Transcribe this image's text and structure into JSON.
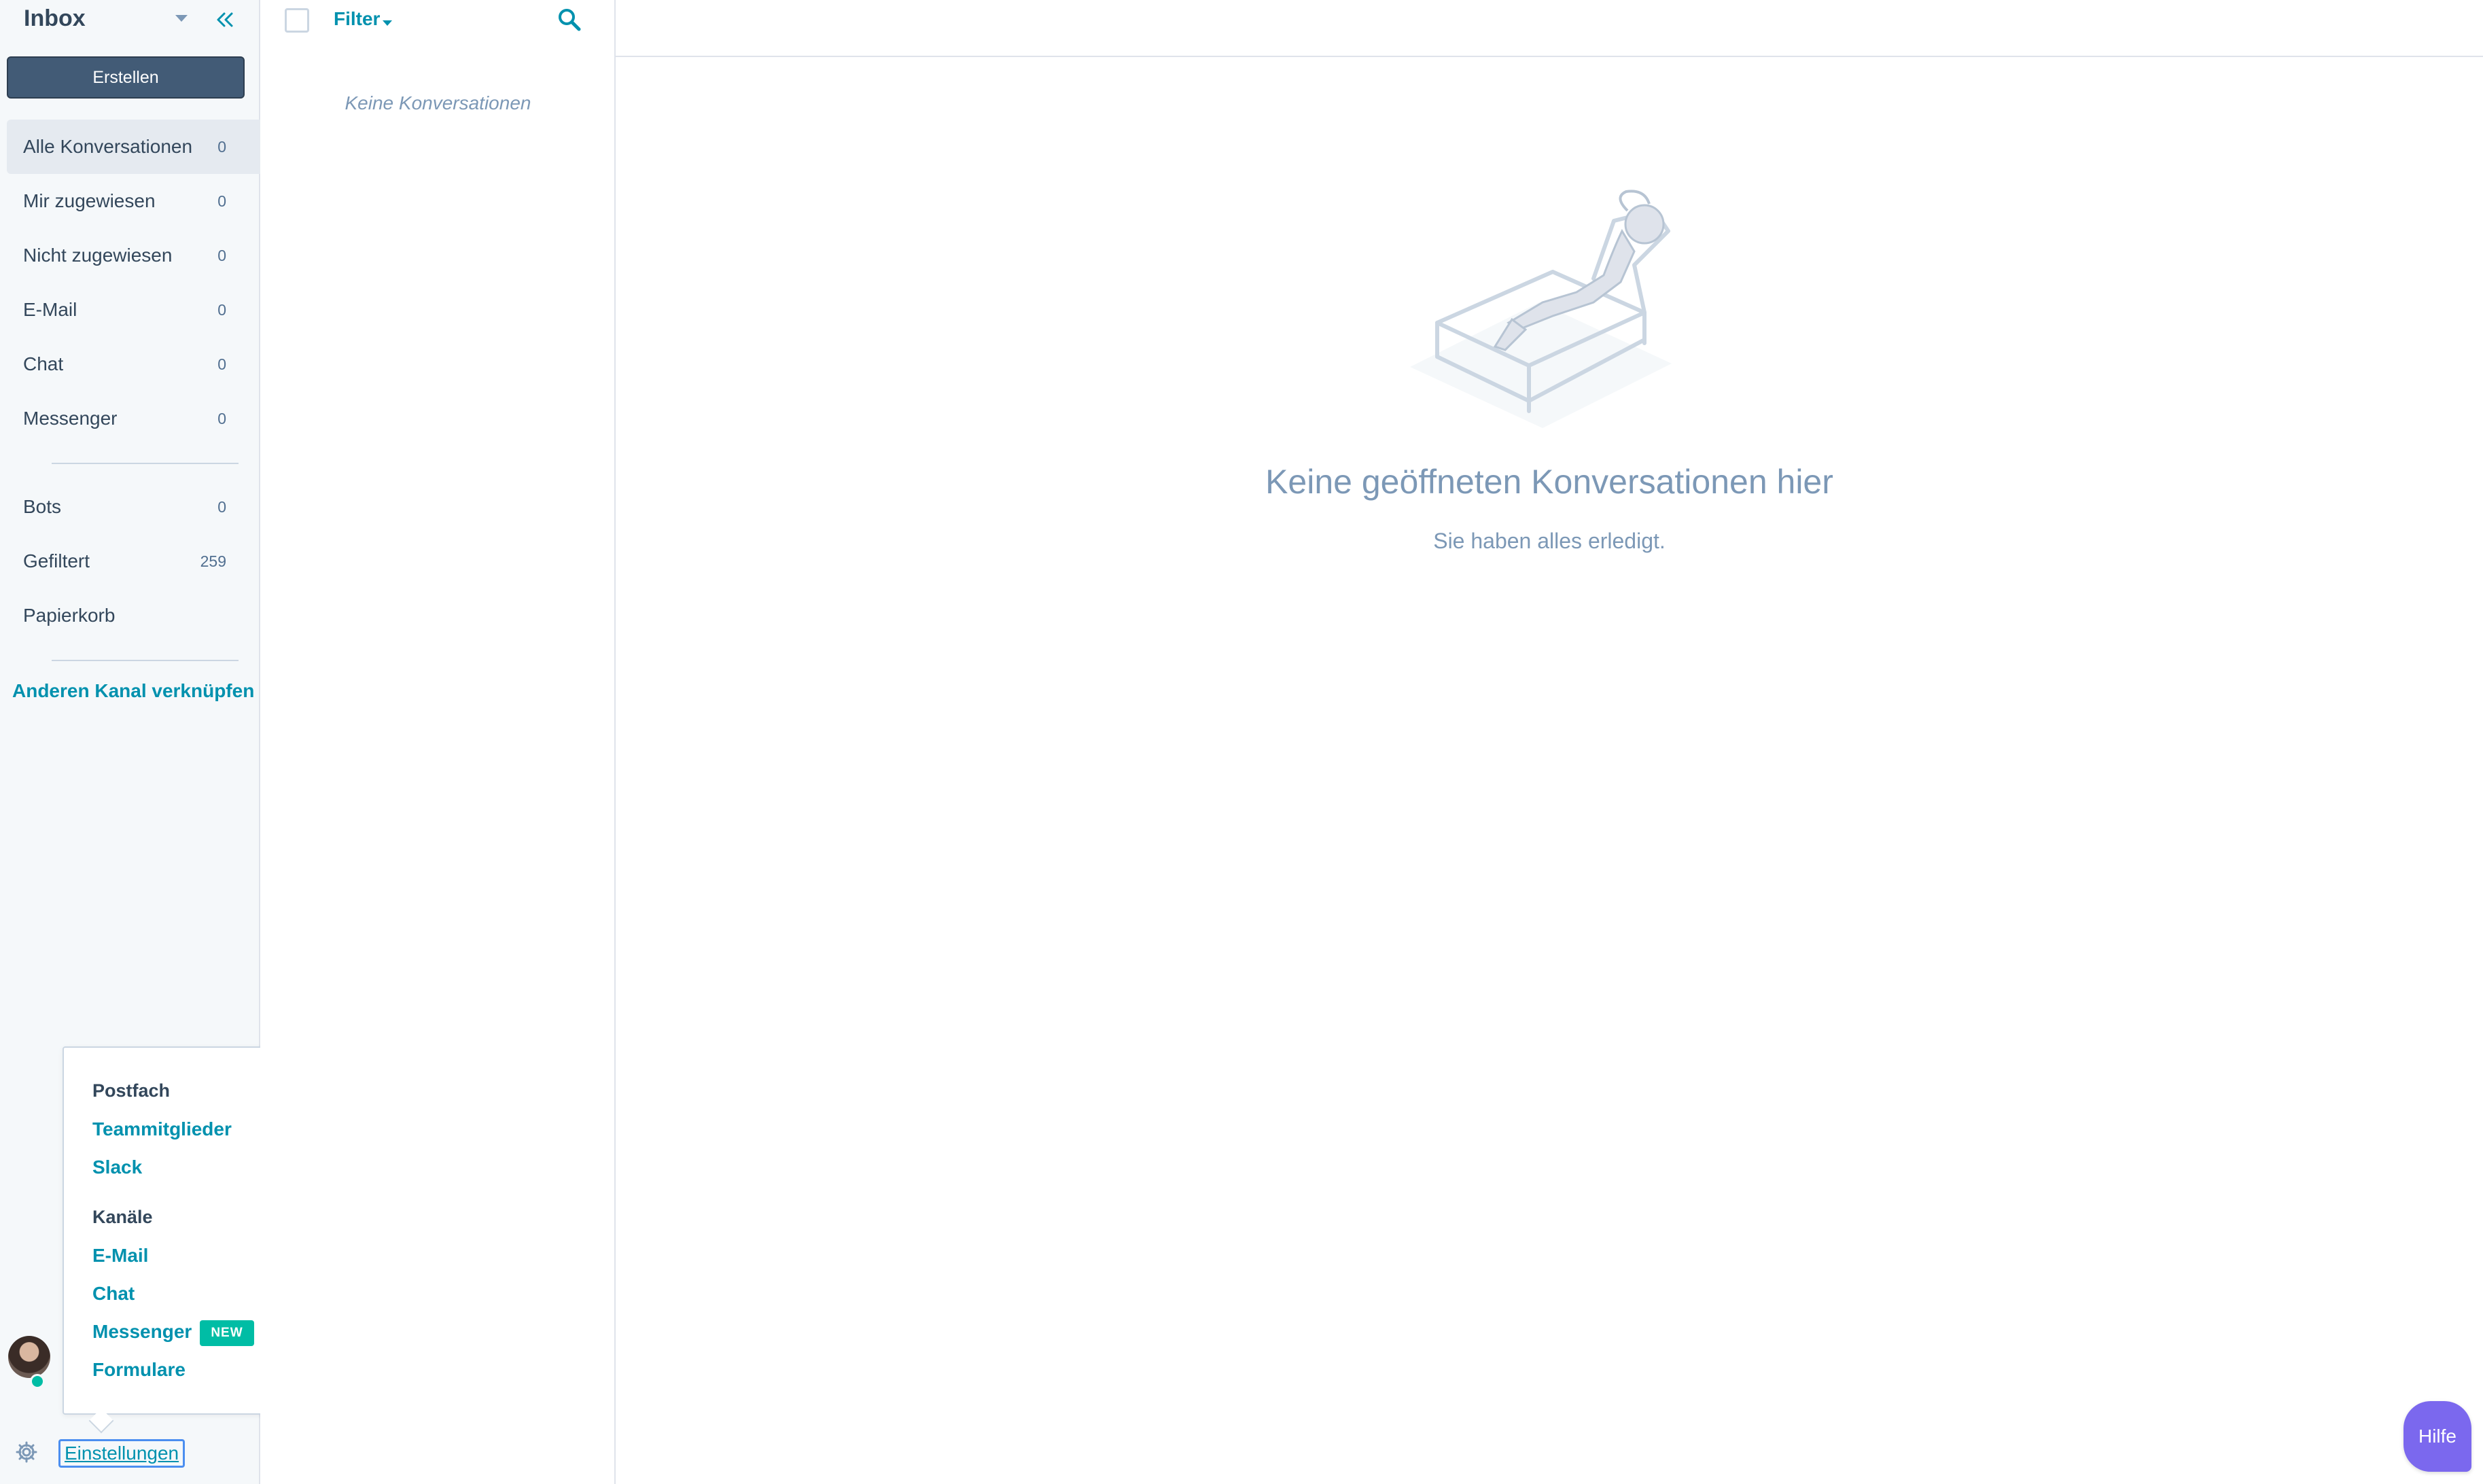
{
  "sidebar": {
    "title": "Inbox",
    "create_label": "Erstellen",
    "items": [
      {
        "label": "Alle Konversationen",
        "count": "0"
      },
      {
        "label": "Mir zugewiesen",
        "count": "0"
      },
      {
        "label": "Nicht zugewiesen",
        "count": "0"
      },
      {
        "label": "E-Mail",
        "count": "0"
      },
      {
        "label": "Chat",
        "count": "0"
      },
      {
        "label": "Messenger",
        "count": "0"
      }
    ],
    "items2": [
      {
        "label": "Bots",
        "count": "0"
      },
      {
        "label": "Gefiltert",
        "count": "259"
      },
      {
        "label": "Papierkorb",
        "count": ""
      }
    ],
    "connect_channel": "Anderen Kanal verknüpfen",
    "settings_label": "Einstellungen"
  },
  "popover": {
    "section1": "Postfach",
    "team": "Teammitglieder",
    "slack": "Slack",
    "section2": "Kanäle",
    "email": "E-Mail",
    "chat": "Chat",
    "messenger": "Messenger",
    "new_badge": "NEW",
    "forms": "Formulare"
  },
  "list": {
    "filter_label": "Filter",
    "empty": "Keine Konversationen"
  },
  "main": {
    "empty_title": "Keine geöffneten Konversationen hier",
    "empty_sub": "Sie haben alles erledigt."
  },
  "help": "Hilfe",
  "colors": {
    "accent": "#0091ae",
    "button": "#425b76",
    "badge": "#00bda5",
    "help": "#7b68ee"
  }
}
